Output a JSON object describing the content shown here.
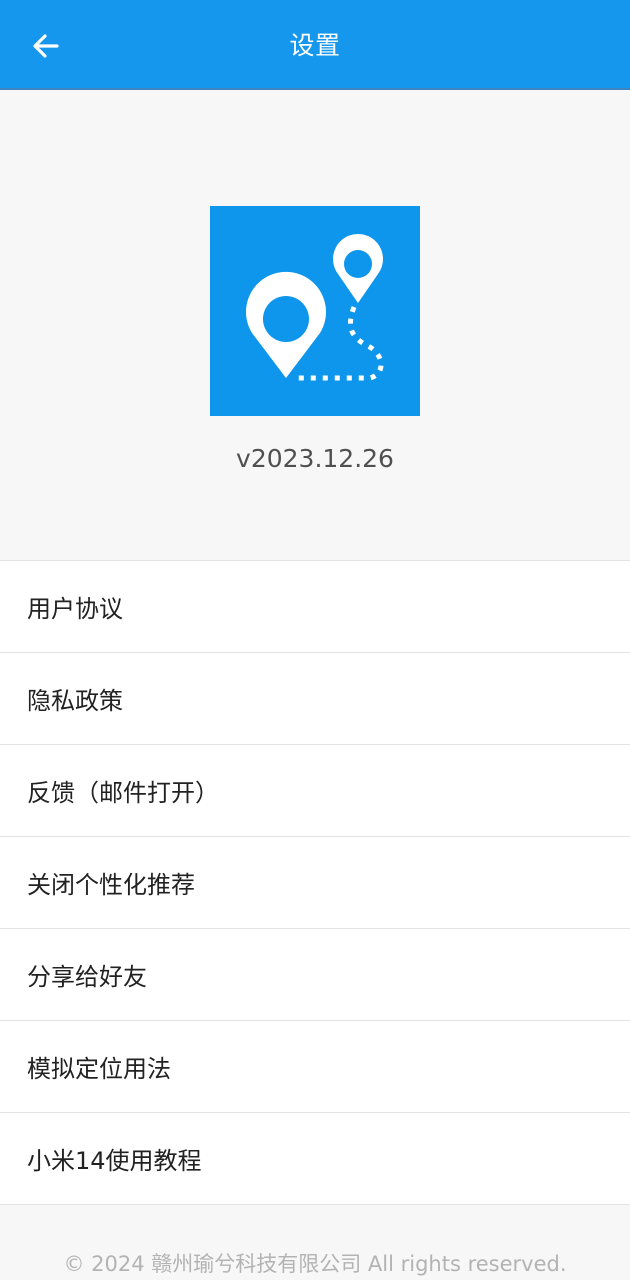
{
  "app_bar": {
    "title": "设置",
    "back_icon": "arrow-left-icon",
    "background": "#1597ee"
  },
  "header": {
    "logo_icon": "map-route-pins-icon",
    "logo_color": "#0e95ec",
    "version": "v2023.12.26"
  },
  "menu": {
    "items": [
      {
        "label": "用户协议"
      },
      {
        "label": "隐私政策"
      },
      {
        "label": "反馈（邮件打开）"
      },
      {
        "label": "关闭个性化推荐"
      },
      {
        "label": "分享给好友"
      },
      {
        "label": "模拟定位用法"
      },
      {
        "label": "小米14使用教程"
      }
    ]
  },
  "footer": {
    "copyright": "© 2024 赣州瑜兮科技有限公司 All rights reserved."
  }
}
